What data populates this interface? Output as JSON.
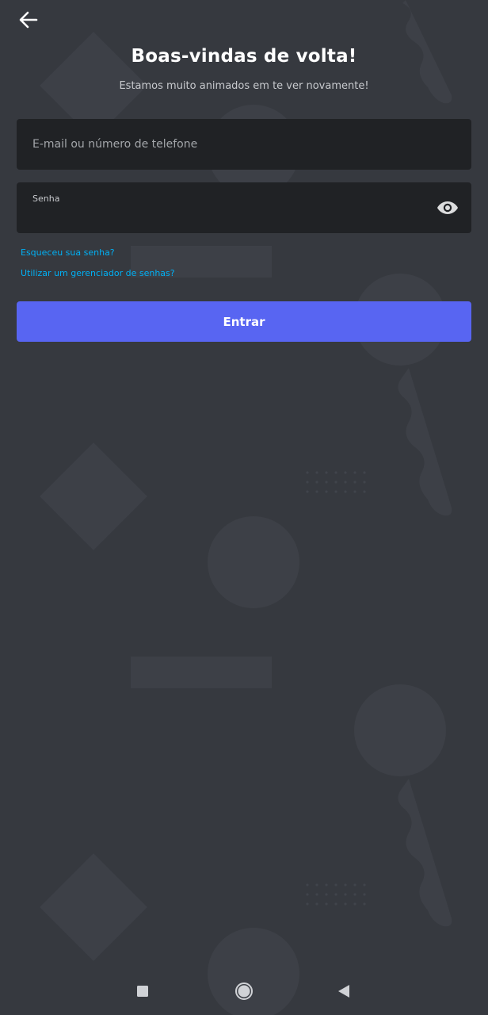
{
  "header": {
    "back_icon": "arrow-left-icon",
    "title": "Boas-vindas de volta!",
    "subtitle": "Estamos muito animados em te ver novamente!"
  },
  "form": {
    "email": {
      "placeholder": "E-mail ou número de telefone",
      "value": ""
    },
    "password": {
      "label": "Senha",
      "value": "",
      "visibility_icon": "eye-icon"
    },
    "forgot_password_link": "Esqueceu sua senha?",
    "password_manager_link": "Utilizar um gerenciador de senhas?",
    "submit_label": "Entrar"
  },
  "system_nav": {
    "recents_icon": "square-icon",
    "home_icon": "circle-icon",
    "back_icon": "triangle-back-icon"
  },
  "colors": {
    "background": "#36393f",
    "field_background": "#202225",
    "accent": "#5865f2",
    "link": "#00b0f4",
    "background_shapes": "#3d4047"
  }
}
